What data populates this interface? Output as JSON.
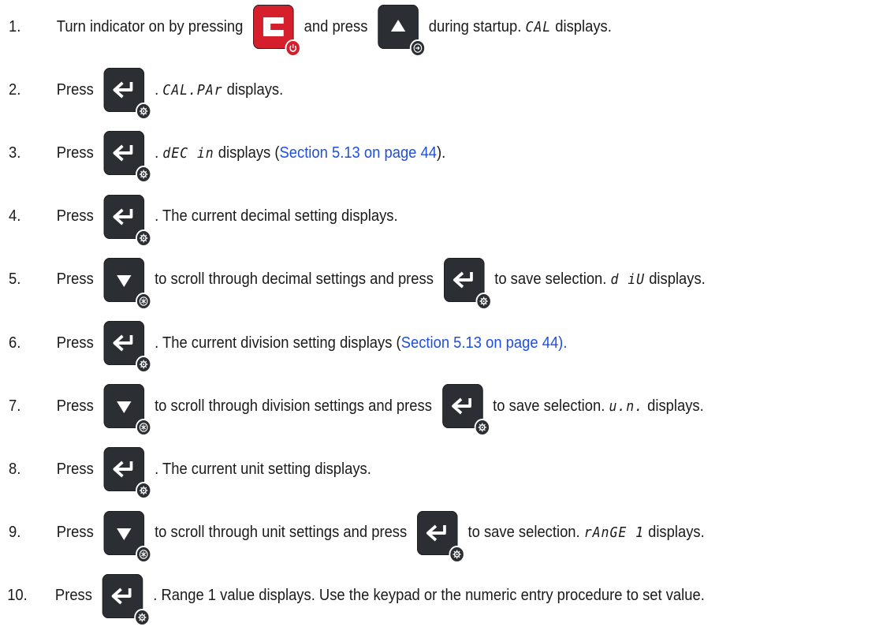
{
  "steps": [
    {
      "n": "1.",
      "parts": [
        {
          "t": "text",
          "v": "Turn indicator on by pressing"
        },
        {
          "t": "key",
          "k": "c"
        },
        {
          "t": "text",
          "v": "and press"
        },
        {
          "t": "key",
          "k": "up"
        },
        {
          "t": "text",
          "v": "during startup. "
        },
        {
          "t": "lcd",
          "v": "CAL"
        },
        {
          "t": "text",
          "v": " displays."
        }
      ]
    },
    {
      "n": "2.",
      "parts": [
        {
          "t": "text",
          "v": "Press"
        },
        {
          "t": "key",
          "k": "enter"
        },
        {
          "t": "text",
          "v": ". "
        },
        {
          "t": "lcd",
          "v": "CAL.PAr"
        },
        {
          "t": "text",
          "v": " displays."
        }
      ]
    },
    {
      "n": "3.",
      "parts": [
        {
          "t": "text",
          "v": "Press"
        },
        {
          "t": "key",
          "k": "enter"
        },
        {
          "t": "text",
          "v": ". "
        },
        {
          "t": "lcd",
          "v": "dEC in"
        },
        {
          "t": "text",
          "v": " displays ("
        },
        {
          "t": "link",
          "v": "Section 5.13 on page 44"
        },
        {
          "t": "text",
          "v": ")."
        }
      ]
    },
    {
      "n": "4.",
      "parts": [
        {
          "t": "text",
          "v": "Press"
        },
        {
          "t": "key",
          "k": "enter"
        },
        {
          "t": "text",
          "v": ". The current decimal setting displays."
        }
      ]
    },
    {
      "n": "5.",
      "parts": [
        {
          "t": "text",
          "v": "Press"
        },
        {
          "t": "key",
          "k": "down"
        },
        {
          "t": "text",
          "v": "to scroll through decimal settings and press"
        },
        {
          "t": "key",
          "k": "enter"
        },
        {
          "t": "text",
          "v": "to save selection. "
        },
        {
          "t": "lcd",
          "v": "d iU"
        },
        {
          "t": "text",
          "v": " displays."
        }
      ]
    },
    {
      "n": "6.",
      "parts": [
        {
          "t": "text",
          "v": "Press"
        },
        {
          "t": "key",
          "k": "enter"
        },
        {
          "t": "text",
          "v": ". The current division setting displays ("
        },
        {
          "t": "link",
          "v": "Section 5.13 on page 44)."
        }
      ]
    },
    {
      "n": "7.",
      "parts": [
        {
          "t": "text",
          "v": "Press"
        },
        {
          "t": "key",
          "k": "down"
        },
        {
          "t": "text",
          "v": "to scroll through division settings and press"
        },
        {
          "t": "key",
          "k": "enter"
        },
        {
          "t": "text",
          "v": "to save selection. "
        },
        {
          "t": "lcd",
          "v": "u.n."
        },
        {
          "t": "text",
          "v": " displays."
        }
      ]
    },
    {
      "n": "8.",
      "parts": [
        {
          "t": "text",
          "v": "Press"
        },
        {
          "t": "key",
          "k": "enter"
        },
        {
          "t": "text",
          "v": ". The current unit setting displays."
        }
      ]
    },
    {
      "n": "9.",
      "parts": [
        {
          "t": "text",
          "v": "Press"
        },
        {
          "t": "key",
          "k": "down"
        },
        {
          "t": "text",
          "v": "to scroll through unit settings and press"
        },
        {
          "t": "key",
          "k": "enter"
        },
        {
          "t": "text",
          "v": "to save selection. "
        },
        {
          "t": "lcd",
          "v": "rAnGE 1"
        },
        {
          "t": "text",
          "v": " displays."
        }
      ]
    },
    {
      "n": "10.",
      "parts": [
        {
          "t": "text",
          "v": "Press"
        },
        {
          "t": "key",
          "k": "enter"
        },
        {
          "t": "text",
          "v": ". Range 1 value displays. Use the keypad or the numeric entry procedure to set value."
        }
      ]
    }
  ],
  "keys": {
    "c": {
      "icon": "c-key-icon",
      "badge": "power-icon",
      "color": "#d61f2c"
    },
    "up": {
      "icon": "up-arrow-key-icon",
      "badge": "input-icon",
      "color": "#2b2e33"
    },
    "down": {
      "icon": "down-arrow-key-icon",
      "badge": "asterisk-icon",
      "color": "#2b2e33"
    },
    "enter": {
      "icon": "enter-key-icon",
      "badge": "gear-icon",
      "color": "#2b2e33"
    }
  },
  "colors": {
    "link": "#1f4fe0",
    "text": "#1a1a1a"
  }
}
